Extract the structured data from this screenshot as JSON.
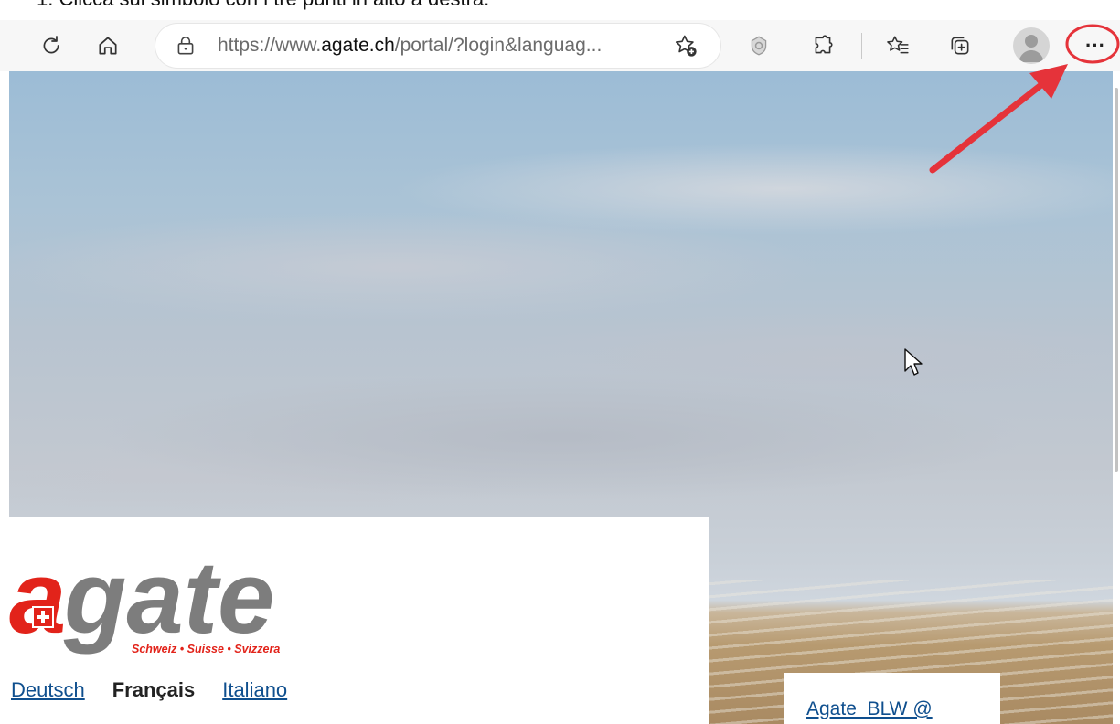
{
  "instruction": "1.  Clicca sul simbolo con i tre punti in alto a destra.",
  "browser": {
    "address_bar": {
      "url_prefix": "https://www.",
      "url_domain": "agate.ch",
      "url_rest": "/portal/?login&languag..."
    },
    "icons": {
      "refresh": "refresh-icon",
      "home": "home-icon",
      "lock": "lock-icon",
      "add_favorite": "add-favorite-icon",
      "tracking": "tracking-prevention-icon",
      "extensions": "extensions-icon",
      "favorites": "favorites-icon",
      "collections": "collections-icon",
      "profile": "avatar",
      "menu": "more-dots-icon"
    },
    "menu_glyph": "···"
  },
  "page": {
    "logo": {
      "wordmark": "agate",
      "tagline": "Schweiz • Suisse • Svizzera"
    },
    "languages": {
      "deutsch": "Deutsch",
      "francais": "Français",
      "italiano": "Italiano"
    },
    "twitter_link": "Agate_BLW @"
  },
  "colors": {
    "logo_red": "#e2231a",
    "logo_gray": "#7d7d7d",
    "link": "#0f4f8e",
    "annotation_red": "#e5333a"
  }
}
